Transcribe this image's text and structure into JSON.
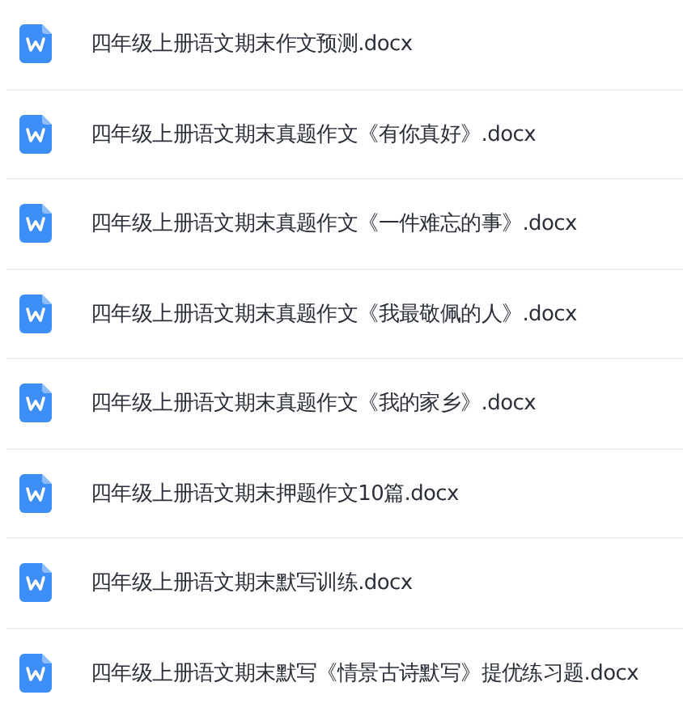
{
  "files": [
    {
      "name": "四年级上册语文期末作文预测.docx"
    },
    {
      "name": "四年级上册语文期末真题作文《有你真好》.docx"
    },
    {
      "name": "四年级上册语文期末真题作文《一件难忘的事》.docx"
    },
    {
      "name": "四年级上册语文期末真题作文《我最敬佩的人》.docx"
    },
    {
      "name": "四年级上册语文期末真题作文《我的家乡》.docx"
    },
    {
      "name": "四年级上册语文期末押题作文10篇.docx"
    },
    {
      "name": "四年级上册语文期末默写训练.docx"
    },
    {
      "name": "四年级上册语文期末默写《情景古诗默写》提优练习题.docx"
    }
  ]
}
